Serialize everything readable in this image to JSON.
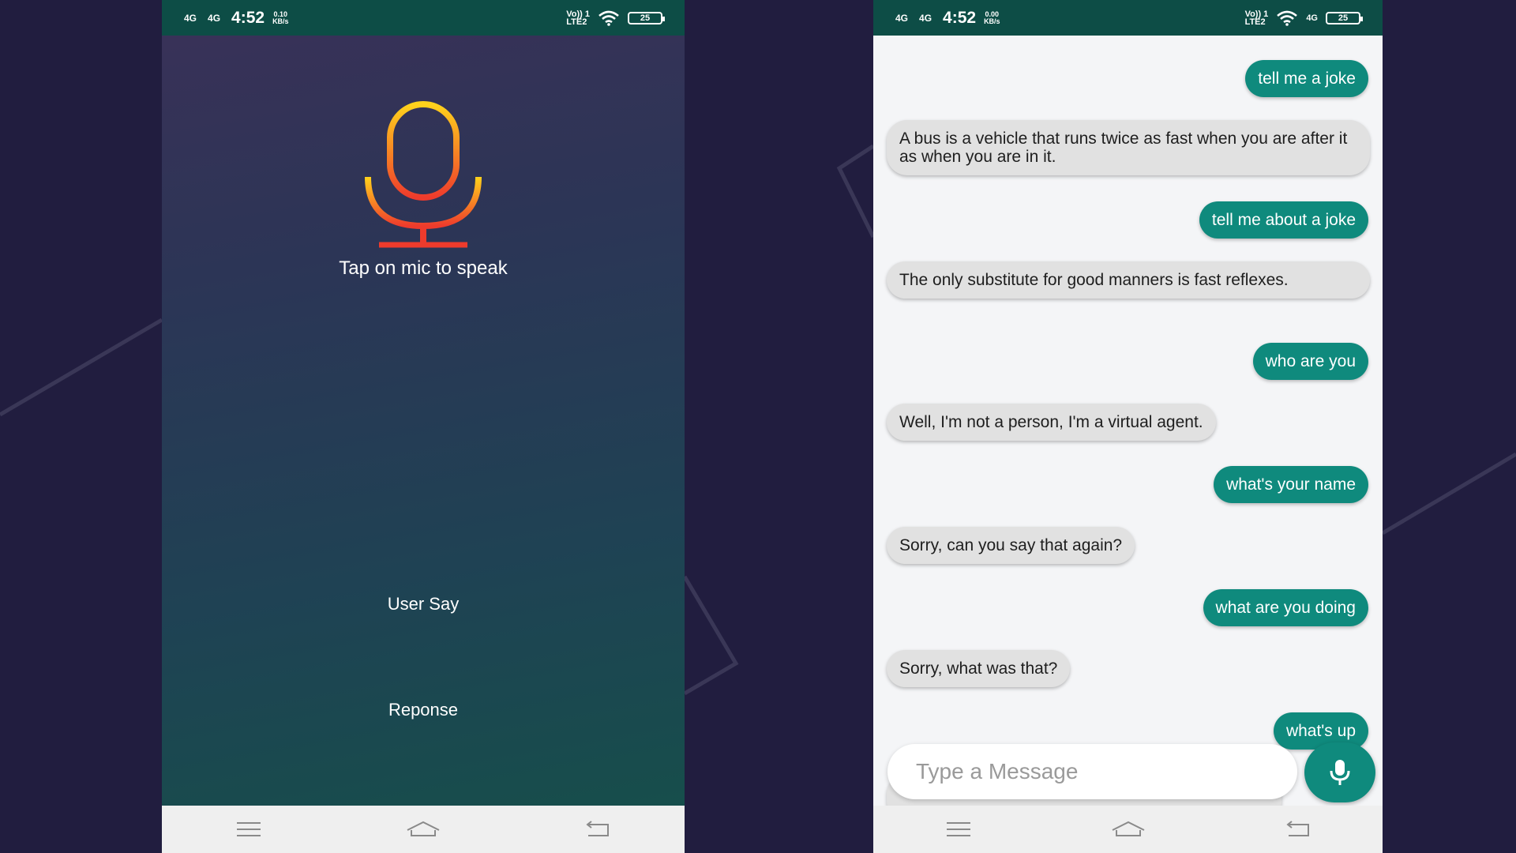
{
  "left_phone": {
    "status": {
      "signal1": "4G",
      "signal2": "4G",
      "time": "4:52",
      "speed_value": "0.10",
      "speed_unit": "KB/s",
      "network_label_top": "Vo)) 1",
      "network_label_bottom": "LTE2",
      "battery": "25"
    },
    "tap_label": "Tap on mic to speak",
    "user_say": "User Say",
    "response": "Reponse",
    "mic_icon": "microphone-icon",
    "nav": [
      "menu-icon",
      "home-icon",
      "back-icon"
    ]
  },
  "right_phone": {
    "status": {
      "signal1": "4G",
      "signal2": "4G",
      "time": "4:52",
      "speed_value": "0.00",
      "speed_unit": "KB/s",
      "network_label_top": "Vo)) 1",
      "network_label_bottom": "LTE2",
      "network_type": "4G",
      "battery": "25"
    },
    "messages": [
      {
        "from": "user",
        "text": "tell me a joke"
      },
      {
        "from": "bot",
        "text": "A bus is a vehicle that runs twice as fast when you are after it as when you are in it."
      },
      {
        "from": "user",
        "text": "tell me about a joke"
      },
      {
        "from": "bot",
        "text": "The only substitute for good manners is fast reflexes."
      },
      {
        "from": "user",
        "text": "who are you"
      },
      {
        "from": "bot",
        "text": "Well, I'm not a person, I'm a virtual agent."
      },
      {
        "from": "user",
        "text": "what's your name"
      },
      {
        "from": "bot",
        "text": "Sorry, can you say that again?"
      },
      {
        "from": "user",
        "text": "what are you doing"
      },
      {
        "from": "bot",
        "text": "Sorry, what was that?"
      },
      {
        "from": "user",
        "text": "what's up"
      }
    ],
    "input_placeholder": "Type a Message",
    "nav": [
      "menu-icon",
      "home-icon",
      "back-icon"
    ]
  },
  "colors": {
    "status_bar": "#0d4d46",
    "user_bubble": "#0f8a7d",
    "bot_bubble": "#e1e1e1",
    "background": "#211d3f"
  }
}
